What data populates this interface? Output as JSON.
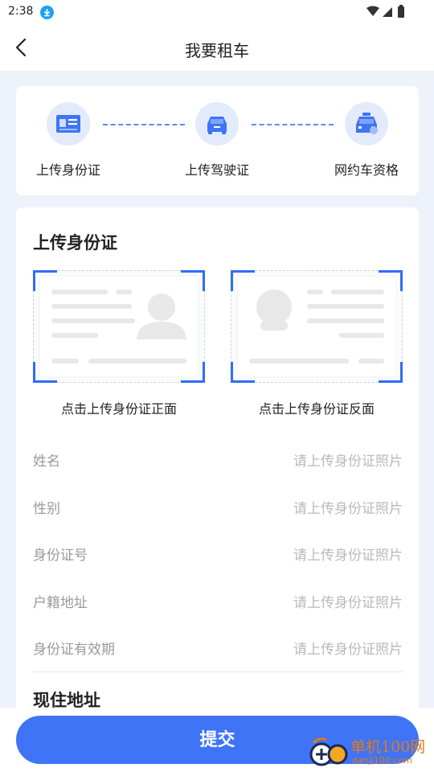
{
  "status_bar": {
    "time": "2:38"
  },
  "header": {
    "title": "我要租车"
  },
  "steps": [
    {
      "label": "上传身份证",
      "icon": "id-card-icon"
    },
    {
      "label": "上传驾驶证",
      "icon": "car-icon"
    },
    {
      "label": "网约车资格",
      "icon": "taxi-icon"
    }
  ],
  "id_section": {
    "title": "上传身份证",
    "front_caption": "点击上传身份证正面",
    "back_caption": "点击上传身份证反面"
  },
  "fields": [
    {
      "label": "姓名",
      "value": "请上传身份证照片"
    },
    {
      "label": "性别",
      "value": "请上传身份证照片"
    },
    {
      "label": "身份证号",
      "value": "请上传身份证照片"
    },
    {
      "label": "户籍地址",
      "value": "请上传身份证照片"
    },
    {
      "label": "身份证有效期",
      "value": "请上传身份证照片"
    }
  ],
  "address_section": {
    "title": "现住地址"
  },
  "submit": {
    "label": "提交"
  },
  "watermark": {
    "name": "单机100网",
    "url": "danji100.com"
  },
  "colors": {
    "accent": "#3e74f5",
    "step_circle": "#e3ebfb",
    "page_bg": "#eef2fb"
  }
}
